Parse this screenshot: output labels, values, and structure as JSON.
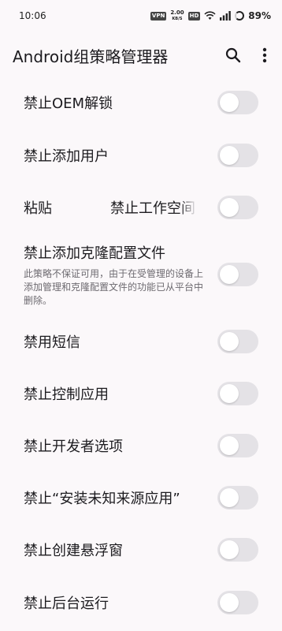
{
  "status_bar": {
    "time": "10:06",
    "vpn_badge": "VPN",
    "net_speed_value": "2.00",
    "net_speed_unit": "KB/S",
    "hd_badge": "HD",
    "battery": "89%"
  },
  "app_bar": {
    "title": "Android组策略管理器",
    "search_icon": "search-icon",
    "more_icon": "more-vert-icon"
  },
  "policies": [
    {
      "title": "禁止OEM解锁",
      "enabled": false
    },
    {
      "title": "禁止添加用户",
      "enabled": false
    },
    {
      "title": "禁止工作空间",
      "paste_label": "粘贴",
      "enabled": false
    },
    {
      "title": "禁止添加克隆配置文件",
      "summary": "此策略不保证可用，由于在受管理的设备上添加管理和克隆配置文件的功能已从平台中删除。",
      "enabled": false
    },
    {
      "title": "禁用短信",
      "enabled": false
    },
    {
      "title": "禁止控制应用",
      "enabled": false
    },
    {
      "title": "禁止开发者选项",
      "enabled": false
    },
    {
      "title": "禁止“安装未知来源应用”",
      "enabled": false
    },
    {
      "title": "禁止创建悬浮窗",
      "enabled": false
    },
    {
      "title": "禁止后台运行",
      "enabled": false
    }
  ],
  "colors": {
    "background": "#fbf8fa",
    "switch_track_off": "#e4e2e6",
    "switch_knob": "#ffffff"
  }
}
